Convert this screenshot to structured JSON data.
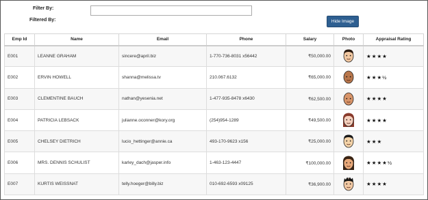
{
  "filter": {
    "filter_by_label": "Filter By:",
    "filtered_by_label": "Filtered By:",
    "input_value": ""
  },
  "hide_button_label": "Hide Image",
  "columns": [
    "Emp Id",
    "Name",
    "Email",
    "Phone",
    "Salary",
    "Photo",
    "Appraisal Rating"
  ],
  "employees": [
    {
      "id": "E001",
      "name": "LEANNE GRAHAM",
      "email": "sincere@april.biz",
      "phone": "1-770-736-8031 x56442",
      "salary": "₹50,000.00",
      "rating": "★★★★",
      "rating_value": 4,
      "photo_icon": "man-short-hair-face-icon",
      "skin": "#f1c7a1",
      "hair": "#2a1a10"
    },
    {
      "id": "E002",
      "name": "ERVIN HOWELL",
      "email": "shanna@melissa.tv",
      "phone": "210.067.6132",
      "salary": "₹65,000.00",
      "rating": "★★★½",
      "rating_value": 3.5,
      "photo_icon": "bald-man-face-icon",
      "skin": "#b9774c",
      "hair": "none"
    },
    {
      "id": "E003",
      "name": "CLEMENTINE BAUCH",
      "email": "nathan@yesenia.net",
      "phone": "1-477-935-8478 x6430",
      "salary": "₹62,500.00",
      "rating": "★★★★",
      "rating_value": 4,
      "photo_icon": "bald-man-face-icon",
      "skin": "#d8956a",
      "hair": "none"
    },
    {
      "id": "E004",
      "name": "PATRICIA LEBSACK",
      "email": "julianne.oconner@kory.org",
      "phone": "(254)954-1289",
      "salary": "₹49,500.00",
      "rating": "★★★★",
      "rating_value": 4.2,
      "photo_icon": "woman-face-icon",
      "skin": "#f6d0bd",
      "hair": "#8a3b2c"
    },
    {
      "id": "E005",
      "name": "CHELSEY DIETRICH",
      "email": "lucio_hettinger@annie.ca",
      "phone": "493-170-9623 x156",
      "salary": "₹25,000.00",
      "rating": "★★★",
      "rating_value": 3.2,
      "photo_icon": "man-dark-hair-face-icon",
      "skin": "#f4d3a8",
      "hair": "#1a1a1a"
    },
    {
      "id": "E006",
      "name": "MRS. DENNIS SCHULIST",
      "email": "karley_dach@jasper.info",
      "phone": "1-463-123-4447",
      "salary": "₹100,000.00",
      "rating": "★★★★½",
      "rating_value": 4.5,
      "photo_icon": "woman-dark-hair-face-icon",
      "skin": "#e8a879",
      "hair": "#3a2414"
    },
    {
      "id": "E007",
      "name": "KURTIS WEISSNAT",
      "email": "telly.hoeger@billy.biz",
      "phone": "010-692-6593 x09125",
      "salary": "₹36,900.00",
      "rating": "★★★★",
      "rating_value": 4,
      "photo_icon": "man-spiky-hair-face-icon",
      "skin": "#f2c9a4",
      "hair": "#111111"
    }
  ]
}
